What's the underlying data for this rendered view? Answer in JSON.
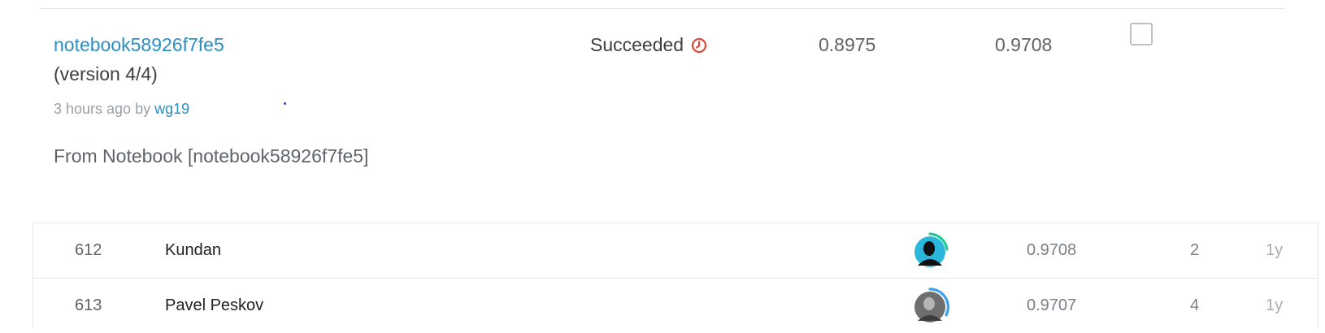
{
  "submission": {
    "name": "notebook58926f7fe5",
    "version": "(version 4/4)",
    "time_ago": "3 hours ago by",
    "author": "wg19",
    "description": "From Notebook [notebook58926f7fe5]",
    "status": "Succeeded",
    "status_icon": "clock-icon",
    "public_score": "0.8975",
    "private_score": "0.9708",
    "selected": false
  },
  "leaderboard": {
    "rows": [
      {
        "rank": "612",
        "team": "Kundan",
        "score": "0.9708",
        "entries": "2",
        "last": "1y",
        "avatar_ring_color": "#20c997"
      },
      {
        "rank": "613",
        "team": "Pavel Peskov",
        "score": "0.9707",
        "entries": "4",
        "last": "1y",
        "avatar_ring_color": "#3aa0f0"
      }
    ]
  },
  "colors": {
    "link": "#2a8fc4",
    "status_icon": "#e0453a"
  }
}
